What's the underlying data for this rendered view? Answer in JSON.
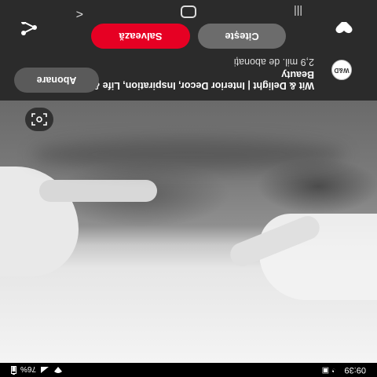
{
  "status_bar": {
    "time": "09:39",
    "battery": "76%",
    "icons": [
      "alarm-icon",
      "message-icon",
      "wifi-icon",
      "signal-icon",
      "battery-icon"
    ]
  },
  "pin": {
    "author_avatar_text": "W&D",
    "author_title": "Wit & Delight | Interior Decor, Inspiration, Life & Beauty",
    "subscribers": "2,9 mil. de abonați",
    "follow_label": "Abonare",
    "save_label": "Salvează",
    "read_label": "Citește"
  },
  "photo": {
    "more_icon": "chevron-right-icon",
    "options_icon": "more-dots-icon",
    "lens_icon": "visual-search-icon"
  },
  "colors": {
    "save_red": "#e60023",
    "panel_dark": "#2b2b2b",
    "pill_grey": "#6c6c6c"
  },
  "nav": {
    "icons": [
      "recent-apps-icon",
      "home-icon",
      "back-icon"
    ]
  }
}
